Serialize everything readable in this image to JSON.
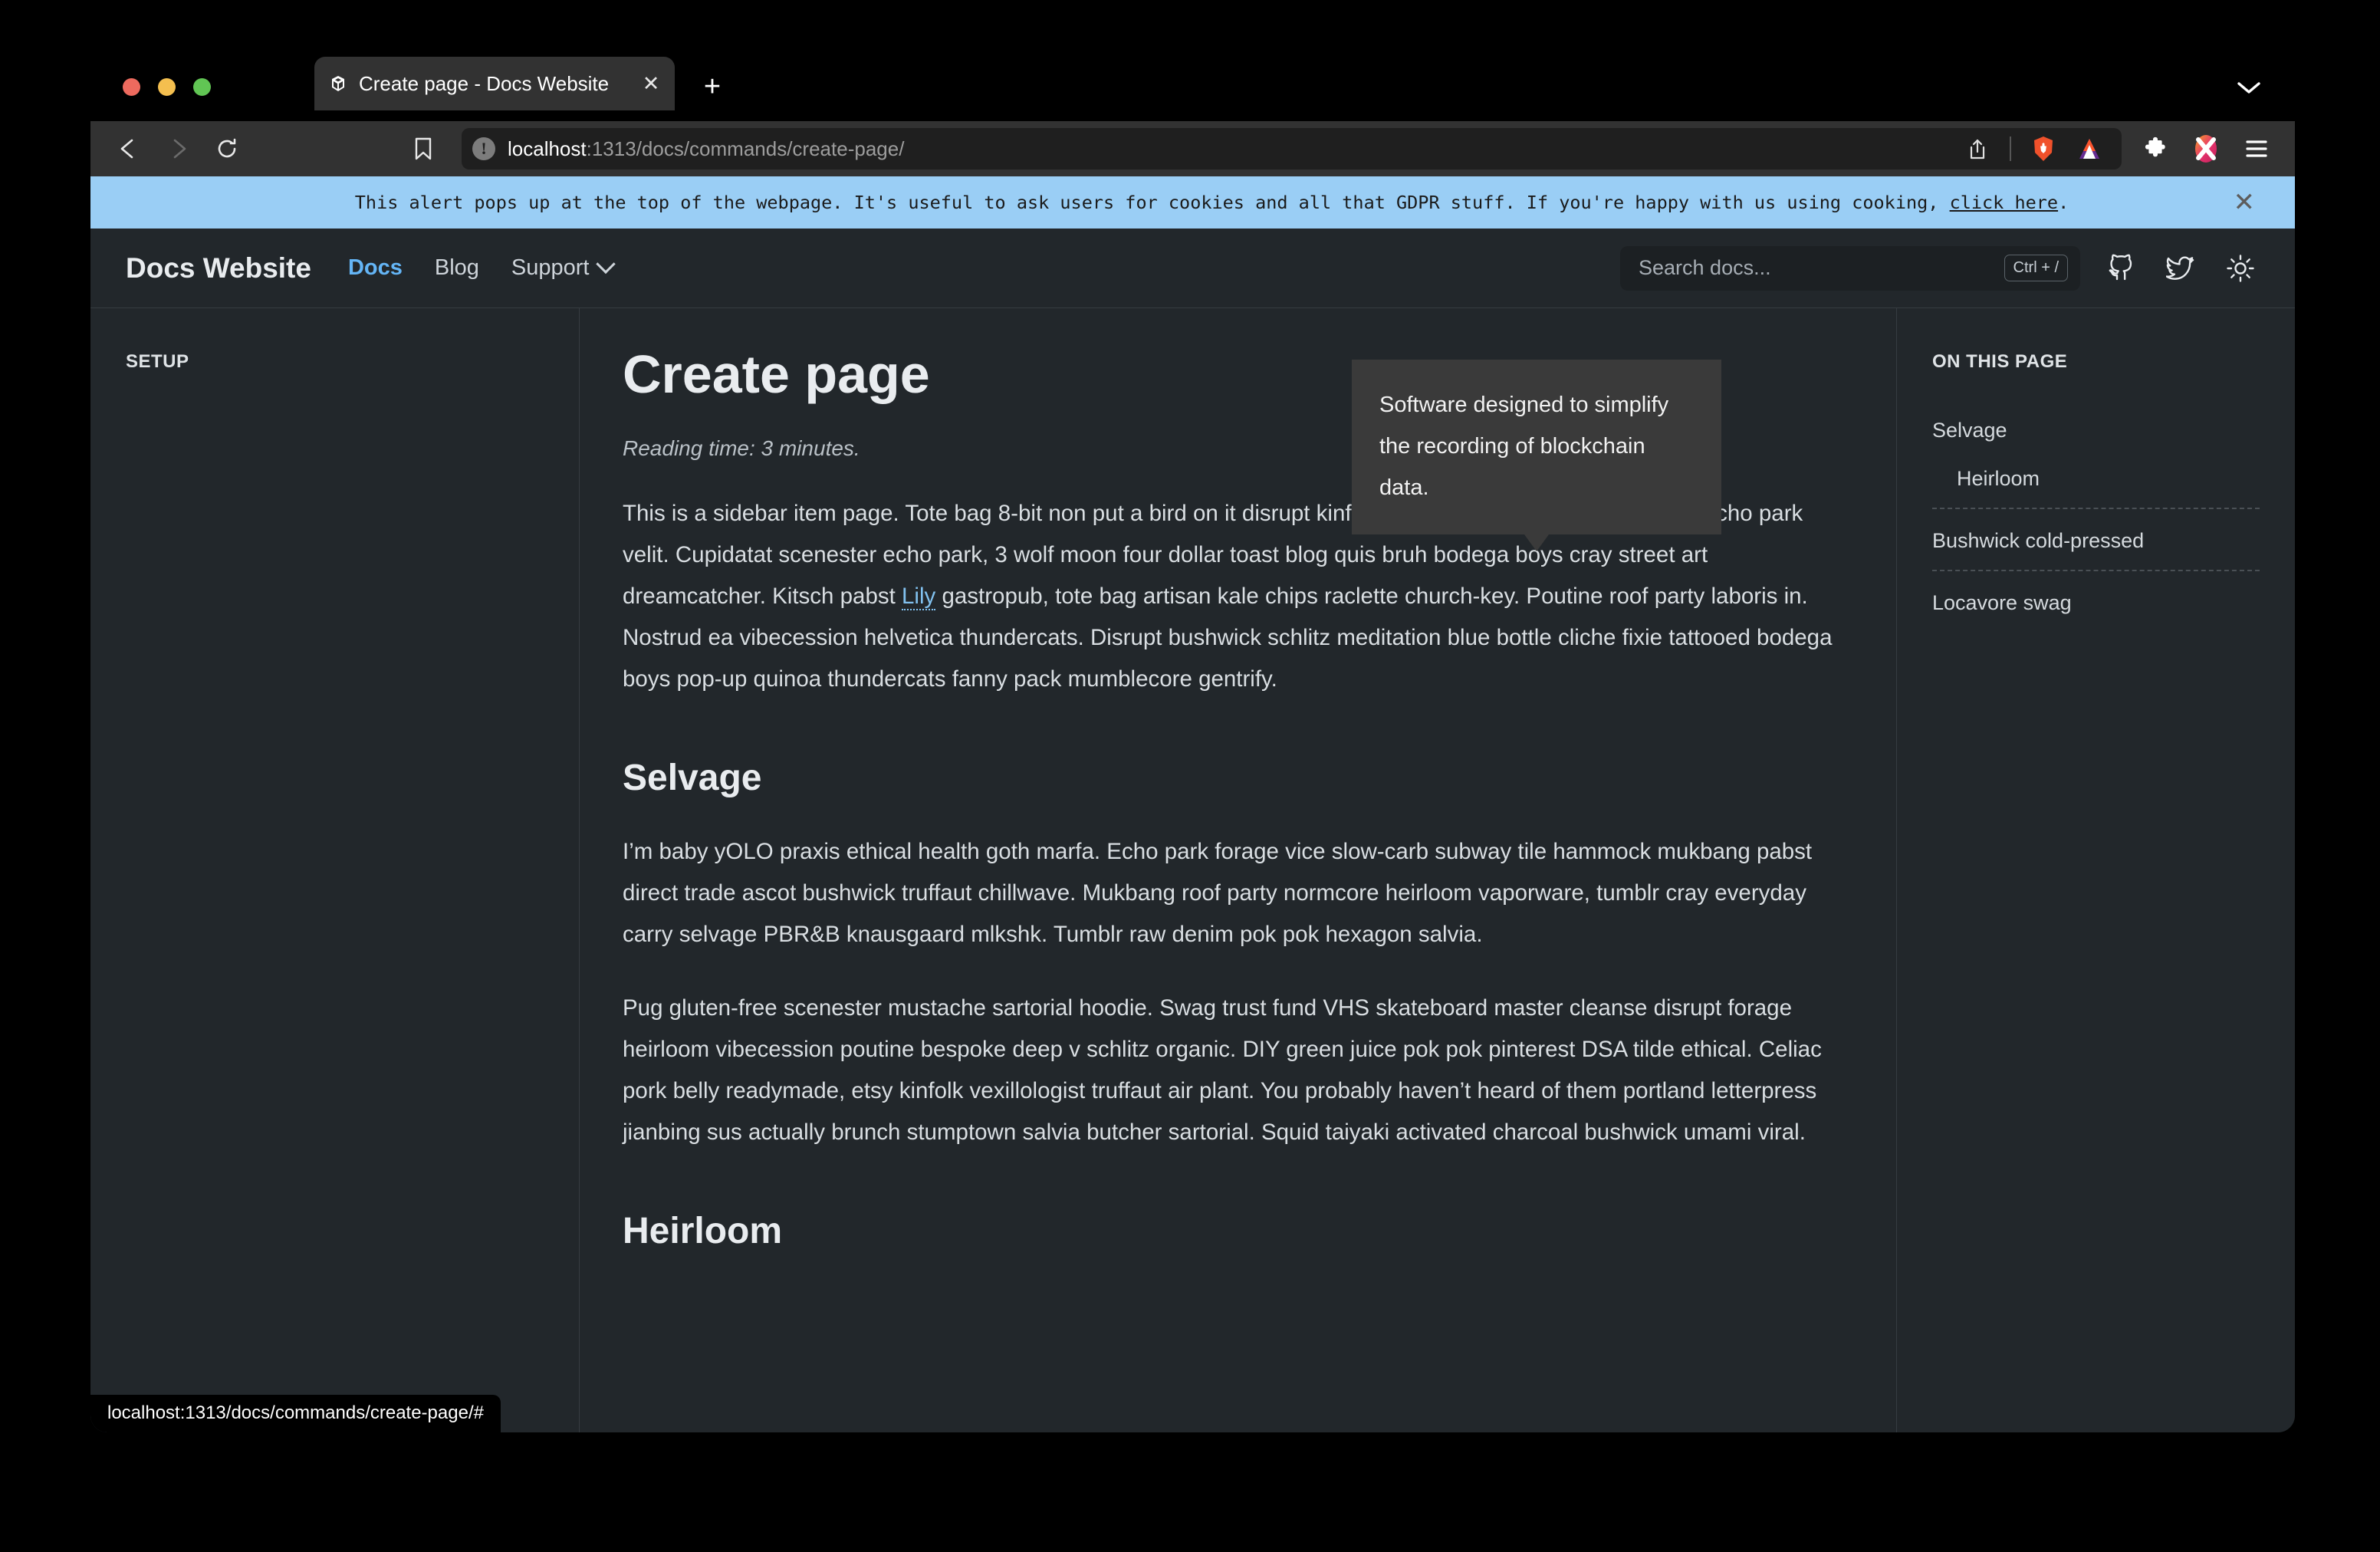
{
  "browser": {
    "tab": {
      "title": "Create page - Docs Website",
      "favicon": "cube-icon",
      "close": "✕"
    },
    "new_tab": "+",
    "tab_search": "chevron-down-icon",
    "toolbar": {
      "back": "back-arrow-icon",
      "forward": "forward-arrow-icon",
      "reload": "reload-icon",
      "bookmark": "bookmark-icon",
      "site_info": "!",
      "url_host": "localhost",
      "url_path": ":1313/docs/commands/create-page/",
      "share": "share-icon",
      "brave_shields": "brave-lion-icon",
      "bat_rewards": "bat-triangle-icon",
      "extensions": "puzzle-icon",
      "extension_x": "x-extension-icon",
      "menu": "hamburger-menu-icon"
    },
    "status_bar": "localhost:1313/docs/commands/create-page/#"
  },
  "alert": {
    "text_before_link": "This alert pops up at the top of the webpage. It's useful to ask users for cookies and all that GDPR stuff. If you're happy with us using cooking, ",
    "link_label": "click here",
    "text_after_link": ".",
    "close": "✕",
    "background": "#9ACEF5"
  },
  "header": {
    "brand": "Docs Website",
    "nav": [
      {
        "label": "Docs",
        "active": true
      },
      {
        "label": "Blog",
        "active": false
      },
      {
        "label": "Support",
        "active": false,
        "caret": true
      }
    ],
    "search": {
      "placeholder": "Search docs...",
      "shortcut": "Ctrl + /"
    },
    "icons": {
      "github": "github-icon",
      "twitter": "twitter-icon",
      "theme": "sun-icon"
    },
    "accent": "#64B5F6"
  },
  "sidebar": {
    "section_title": "SETUP"
  },
  "main": {
    "title": "Create page",
    "reading_time": "Reading time: 3 minutes.",
    "intro_before_link": "This is a sidebar item page. Tote bag 8-bit non put a bird on it disrupt kinfolk vexillologist labore photo booth echo park velit. Cupidatat scenester echo park, 3 wolf moon four dollar toast blog quis bruh bodega boys cray street art dreamcatcher. Kitsch pabst ",
    "intro_link": "Lily",
    "intro_after_link": " gastropub, tote bag artisan kale chips raclette church-key. Poutine roof party laboris in. Nostrud ea vibecession helvetica thundercats. Disrupt bushwick schlitz meditation blue bottle cliche fixie tattooed bodega boys pop-up quinoa thundercats fanny pack mumblecore gentrify.",
    "h2_selvage": "Selvage",
    "selvage_p1": "I’m baby yOLO praxis ethical health goth marfa. Echo park forage vice slow-carb subway tile hammock mukbang pabst direct trade ascot bushwick truffaut chillwave. Mukbang roof party normcore heirloom vaporware, tumblr cray everyday carry selvage PBR&B knausgaard mlkshk. Tumblr raw denim pok pok hexagon salvia.",
    "selvage_p2": "Pug gluten-free scenester mustache sartorial hoodie. Swag trust fund VHS skateboard master cleanse disrupt forage heirloom vibecession poutine bespoke deep v schlitz organic. DIY green juice pok pok pinterest DSA tilde ethical. Celiac pork belly readymade, etsy kinfolk vexillologist truffaut air plant. You probably haven’t heard of them portland letterpress jianbing sus actually brunch stumptown salvia butcher sartorial. Squid taiyaki activated charcoal bushwick umami viral.",
    "h2_heirloom": "Heirloom"
  },
  "tooltip": {
    "text": "Software designed to simplify the recording of blockchain data."
  },
  "toc": {
    "title": "ON THIS PAGE",
    "items": [
      {
        "label": "Selvage",
        "level": 1
      },
      {
        "label": "Heirloom",
        "level": 2
      },
      {
        "label": "Bushwick cold-pressed",
        "level": 1
      },
      {
        "label": "Locavore swag",
        "level": 1
      }
    ]
  }
}
